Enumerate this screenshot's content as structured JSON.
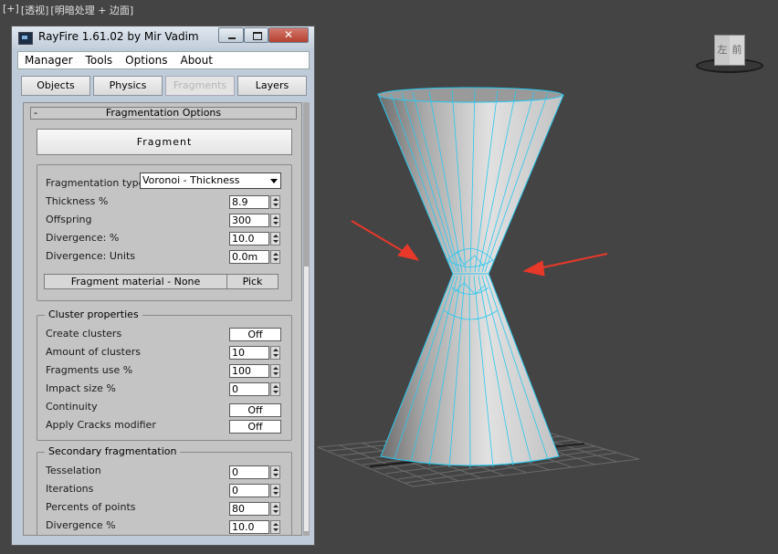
{
  "viewport": {
    "label_plus": "[+]",
    "label_view": "[透视]",
    "label_shading": "[明暗处理 + 边面]",
    "viewcube_left": "左",
    "viewcube_front": "前"
  },
  "window": {
    "title": "RayFire 1.61.02  by Mir Vadim",
    "close_glyph": "✕"
  },
  "menu": [
    "Manager",
    "Tools",
    "Options",
    "About"
  ],
  "tabs": [
    {
      "label": "Objects",
      "active": false
    },
    {
      "label": "Physics",
      "active": false
    },
    {
      "label": "Fragments",
      "active": true
    },
    {
      "label": "Layers",
      "active": false
    }
  ],
  "fragmentation_options": {
    "collapse": "-",
    "title": "Fragmentation Options",
    "fragment_button": "Fragment",
    "type_label": "Fragmentation type",
    "type_value": "Voronoi - Thickness",
    "thickness_label": "Thickness %",
    "thickness_value": "8.9",
    "offspring_label": "Offspring",
    "offspring_value": "300",
    "divergence_pct_label": "Divergence: %",
    "divergence_pct_value": "10.0",
    "divergence_units_label": "Divergence: Units",
    "divergence_units_value": "0.0m",
    "material_button": "Fragment material - None",
    "pick_button": "Pick"
  },
  "cluster": {
    "title": "Cluster properties",
    "create_label": "Create clusters",
    "create_value": "Off",
    "amount_label": "Amount of clusters",
    "amount_value": "10",
    "use_label": "Fragments use %",
    "use_value": "100",
    "impact_label": "Impact size %",
    "impact_value": "0",
    "continuity_label": "Continuity",
    "continuity_value": "Off",
    "cracks_label": "Apply Cracks modifier",
    "cracks_value": "Off"
  },
  "secondary": {
    "title": "Secondary fragmentation",
    "tess_label": "Tesselation",
    "tess_value": "0",
    "iter_label": "Iterations",
    "iter_value": "0",
    "points_label": "Percents of points",
    "points_value": "80",
    "div_label": "Divergence %",
    "div_value": "10.0"
  },
  "colors": {
    "viewport_bg": "#444444",
    "wire": "#28c8f0",
    "arrow": "#e8382a"
  }
}
